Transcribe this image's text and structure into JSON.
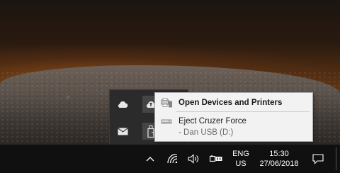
{
  "tray_overflow": {
    "icons": [
      "cloud-icon",
      "cloud-upload-icon",
      "mail-icon",
      "usb-drive-icon"
    ]
  },
  "context_menu": {
    "items": [
      {
        "label": "Open Devices and Printers",
        "icon": "devices-printers-icon",
        "bold": true
      },
      {
        "label": "Eject Cruzer Force",
        "icon": "usb-drive-icon"
      }
    ],
    "subitem": "- Dan USB (D:)"
  },
  "taskbar": {
    "language_line1": "ENG",
    "language_line2": "US",
    "time": "15:30",
    "date": "27/06/2018",
    "icons": [
      "chevron-up-icon",
      "wifi-icon",
      "volume-icon",
      "battery-icon",
      "notification-icon"
    ]
  }
}
